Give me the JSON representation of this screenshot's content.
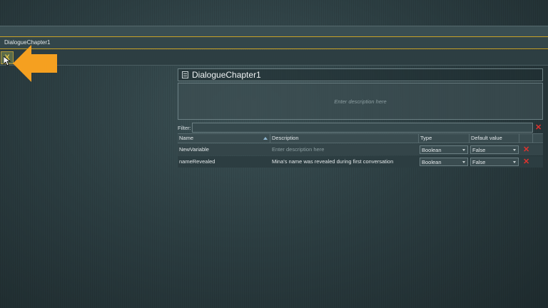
{
  "window": {
    "tab_label": "DialogueChapter1"
  },
  "toolbar": {
    "close_label": "X"
  },
  "variables_panel": {
    "title": "DialogueChapter1",
    "description_placeholder": "Enter description here",
    "filter_label": "Filter:",
    "filter_value": "",
    "columns": {
      "name": "Name",
      "description": "Description",
      "type": "Type",
      "default": "Default value"
    },
    "rows": [
      {
        "name": "NewVariable",
        "description": "",
        "description_placeholder": "Enter description here",
        "type": "Boolean",
        "default": "False"
      },
      {
        "name": "nameRevealed",
        "description": "Mina's name was revealed during first conversation",
        "description_placeholder": "",
        "type": "Boolean",
        "default": "False"
      }
    ],
    "delete_glyph": "✕"
  },
  "colors": {
    "accent_gold": "#c9a227",
    "arrow_orange": "#f5a020",
    "delete_red": "#e0332e"
  }
}
